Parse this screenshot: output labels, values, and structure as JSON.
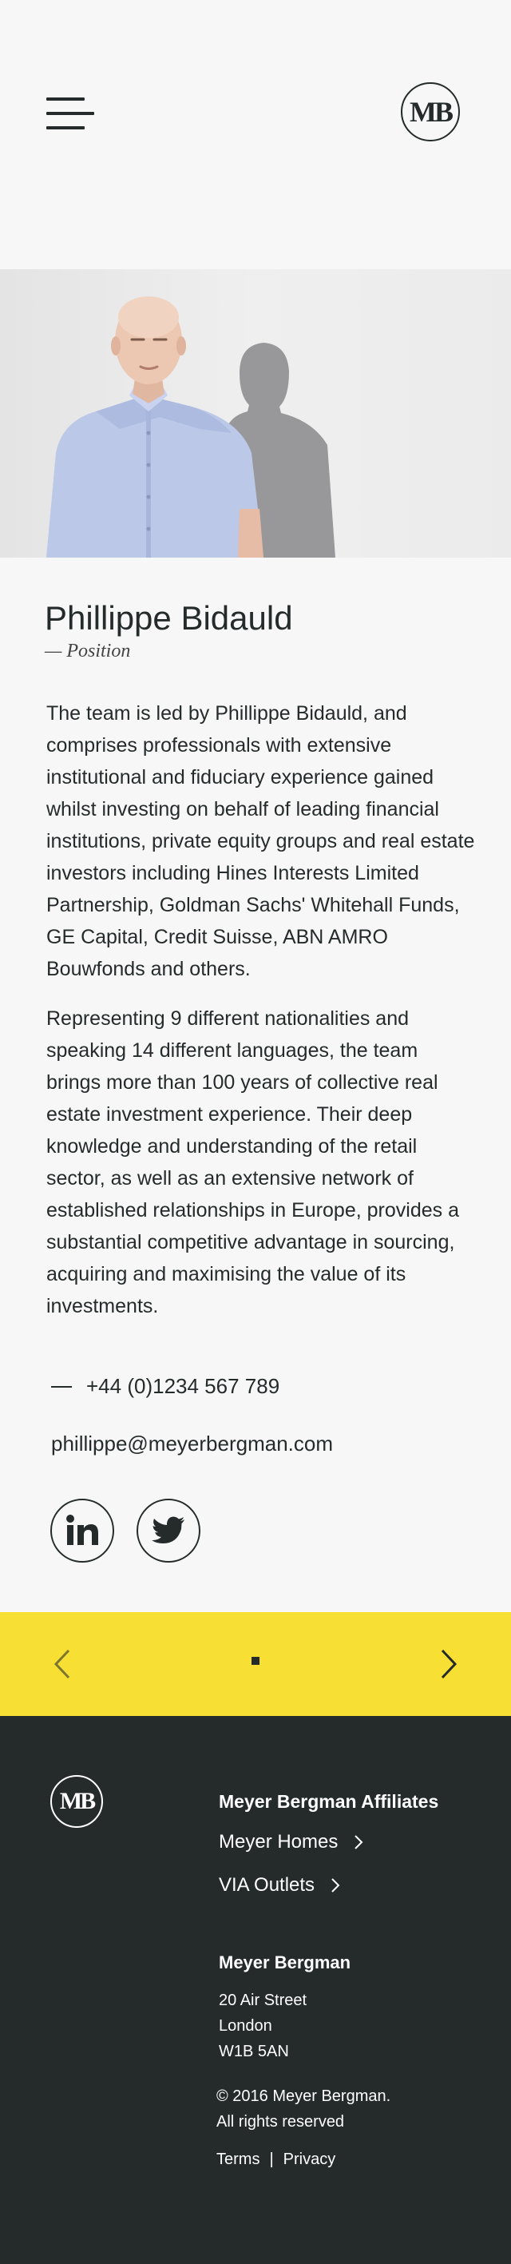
{
  "header": {
    "menu_icon": "hamburger-icon",
    "logo_text": "MB"
  },
  "hero": {
    "image": "portrait photo of Phillippe Bidauld"
  },
  "profile": {
    "name": "Phillippe Bidauld",
    "position": "— Position",
    "bio": [
      "The team is led by Phillippe Bidauld, and comprises professionals with extensive institutional and fiduciary experience gained whilst investing on behalf of leading financial institutions, private equity groups and real estate investors including Hines Interests Limited Partnership, Goldman Sachs' Whitehall Funds, GE Capital, Credit Suisse, ABN AMRO Bouwfonds and others.",
      "Representing 9 different nationalities and speaking 14 different languages, the team brings more than 100 years of collective real estate investment experience. Their deep knowledge and understanding of the retail sector, as well as an extensive network of established relationships in Europe, provides a substantial competitive advantage in sourcing, acquiring and maximising the value of its investments."
    ],
    "phone": "+44 (0)1234 567 789",
    "email": "phillippe@meyerbergman.com",
    "social": [
      "linkedin-icon",
      "twitter-icon"
    ]
  },
  "slider": {
    "prev_icon": "chevron-left-icon",
    "next_icon": "chevron-right-icon",
    "accent": "#f7df33"
  },
  "footer": {
    "logo_text": "MB",
    "affiliates_heading": "Meyer Bergman Affiliates",
    "affiliates": [
      "Meyer Homes",
      "VIA Outlets"
    ],
    "company_heading": "Meyer Bergman",
    "address": [
      "20 Air Street",
      "London",
      "W1B 5AN"
    ],
    "copyright": [
      "© 2016 Meyer Bergman.",
      "All rights reserved"
    ],
    "terms": "Terms",
    "separator": "|",
    "privacy": "Privacy",
    "background": "#252b2b"
  }
}
